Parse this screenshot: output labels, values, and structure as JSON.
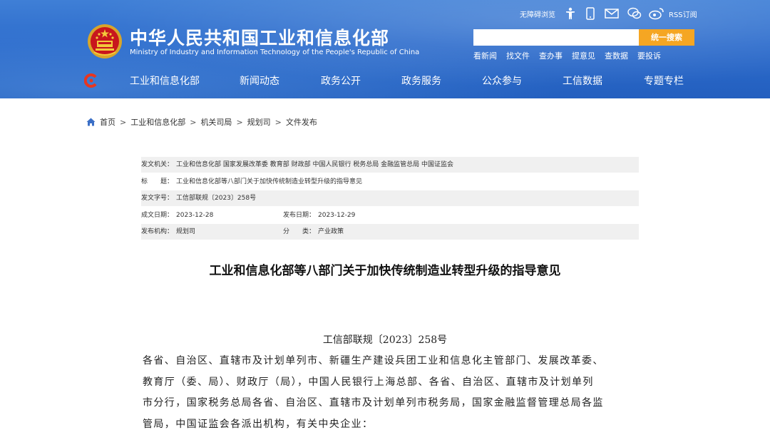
{
  "header": {
    "title": "中华人民共和国工业和信息化部",
    "subtitle": "Ministry of Industry and Information Technology of the People's Republic of China",
    "toolbar": {
      "accessibility": "无障碍浏览",
      "rss": "RSS订阅",
      "icons": [
        "accessibility-person-icon",
        "mobile-phone-icon",
        "mail-icon",
        "wechat-icon",
        "weibo-icon"
      ]
    },
    "search": {
      "placeholder": "",
      "button": "统一搜索"
    },
    "quicklinks": [
      "看新闻",
      "找文件",
      "查办事",
      "提意见",
      "查数据",
      "要投诉"
    ]
  },
  "nav": {
    "items": [
      "工业和信息化部",
      "新闻动态",
      "政务公开",
      "政务服务",
      "公众参与",
      "工信数据",
      "专题专栏"
    ]
  },
  "breadcrumb": [
    "首页",
    "工业和信息化部",
    "机关司局",
    "规划司",
    "文件发布"
  ],
  "meta": {
    "issuer_label": "发文机关：",
    "issuer": "工业和信息化部 国家发展改革委 教育部 财政部 中国人民银行 税务总局 金融监管总局 中国证监会",
    "title_label": "标　　题：",
    "title": "工业和信息化部等八部门关于加快传统制造业转型升级的指导意见",
    "doc_no_label": "发文字号：",
    "doc_no": "工信部联规〔2023〕258号",
    "created_label": "成文日期：",
    "created": "2023-12-28",
    "published_label": "发布日期：",
    "published": "2023-12-29",
    "org_label": "发布机构：",
    "org": "规划司",
    "category_label": "分　　类：",
    "category": "产业政策"
  },
  "document": {
    "title": "工业和信息化部等八部门关于加快传统制造业转型升级的指导意见",
    "number": "工信部联规〔2023〕258号",
    "lines": [
      "各省、自治区、直辖市及计划单列市、新疆生产建设兵团工业和信息化主管部门、发展改革委、",
      "教育厅（委、局）、财政厅（局），中国人民银行上海总部、各省、自治区、直辖市及计划单列",
      "市分行，国家税务总局各省、自治区、直辖市及计划单列市税务局，国家金融监督管理总局各监",
      "管局，中国证监会各派出机构，有关中央企业："
    ]
  },
  "colors": {
    "header_blue": "#2d6ccc",
    "search_button": "#f5a623",
    "meta_shade": "#f0f0f0"
  }
}
